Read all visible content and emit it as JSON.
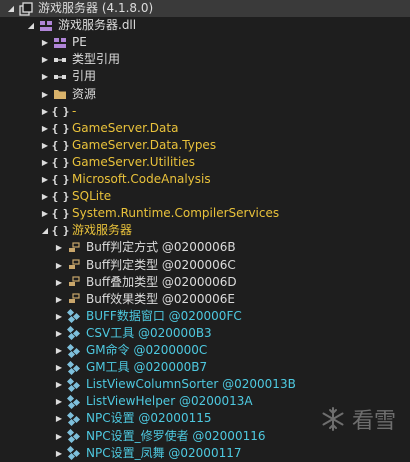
{
  "colors": {
    "namespace_text": "#e9c23b",
    "type_text": "#4ec9e0",
    "default_text": "#dcdcdc",
    "enum_icon": "#c9a66b",
    "class_icon": "#7ec0dc"
  },
  "tree": [
    {
      "label": "游戏服务器 (4.1.8.0)",
      "indent": 0,
      "arrow": "down",
      "icon": "assembly-icon",
      "color": "#dcdcdc",
      "selected": true
    },
    {
      "label": "游戏服务器.dll",
      "indent": 1,
      "arrow": "down",
      "icon": "module-icon",
      "color": "#dcdcdc"
    },
    {
      "label": "PE",
      "indent": 2,
      "arrow": "right",
      "icon": "pe-icon",
      "color": "#dcdcdc"
    },
    {
      "label": "类型引用",
      "indent": 2,
      "arrow": "right",
      "icon": "type-ref-icon",
      "color": "#dcdcdc"
    },
    {
      "label": "引用",
      "indent": 2,
      "arrow": "right",
      "icon": "reference-icon",
      "color": "#dcdcdc"
    },
    {
      "label": "资源",
      "indent": 2,
      "arrow": "right",
      "icon": "folder-icon",
      "color": "#dcdcdc"
    },
    {
      "label": "-",
      "indent": 2,
      "arrow": "right",
      "icon": "namespace-icon",
      "color": "#e9c23b"
    },
    {
      "label": "GameServer.Data",
      "indent": 2,
      "arrow": "right",
      "icon": "namespace-icon",
      "color": "#e9c23b"
    },
    {
      "label": "GameServer.Data.Types",
      "indent": 2,
      "arrow": "right",
      "icon": "namespace-icon",
      "color": "#e9c23b"
    },
    {
      "label": "GameServer.Utilities",
      "indent": 2,
      "arrow": "right",
      "icon": "namespace-icon",
      "color": "#e9c23b"
    },
    {
      "label": "Microsoft.CodeAnalysis",
      "indent": 2,
      "arrow": "right",
      "icon": "namespace-icon",
      "color": "#e9c23b"
    },
    {
      "label": "SQLite",
      "indent": 2,
      "arrow": "right",
      "icon": "namespace-icon",
      "color": "#e9c23b"
    },
    {
      "label": "System.Runtime.CompilerServices",
      "indent": 2,
      "arrow": "right",
      "icon": "namespace-icon",
      "color": "#e9c23b"
    },
    {
      "label": "游戏服务器",
      "indent": 2,
      "arrow": "down",
      "icon": "namespace-icon",
      "color": "#e9c23b"
    },
    {
      "label": "Buff判定方式 @0200006B",
      "indent": 3,
      "arrow": "right",
      "icon": "enum-icon",
      "color": "#dcdcdc"
    },
    {
      "label": "Buff判定类型 @0200006C",
      "indent": 3,
      "arrow": "right",
      "icon": "enum-icon",
      "color": "#dcdcdc"
    },
    {
      "label": "Buff叠加类型 @0200006D",
      "indent": 3,
      "arrow": "right",
      "icon": "enum-icon",
      "color": "#dcdcdc"
    },
    {
      "label": "Buff效果类型 @0200006E",
      "indent": 3,
      "arrow": "right",
      "icon": "enum-icon",
      "color": "#dcdcdc"
    },
    {
      "label": "BUFF数据窗口 @020000FC",
      "indent": 3,
      "arrow": "right",
      "icon": "class-icon",
      "color": "#4ec9e0"
    },
    {
      "label": "CSV工具 @020000B3",
      "indent": 3,
      "arrow": "right",
      "icon": "class-icon",
      "color": "#4ec9e0"
    },
    {
      "label": "GM命令 @0200000C",
      "indent": 3,
      "arrow": "right",
      "icon": "class-icon",
      "color": "#4ec9e0"
    },
    {
      "label": "GM工具 @020000B7",
      "indent": 3,
      "arrow": "right",
      "icon": "class-icon",
      "color": "#4ec9e0"
    },
    {
      "label": "ListViewColumnSorter @0200013B",
      "indent": 3,
      "arrow": "right",
      "icon": "class-icon",
      "color": "#4ec9e0"
    },
    {
      "label": "ListViewHelper @0200013A",
      "indent": 3,
      "arrow": "right",
      "icon": "class-icon",
      "color": "#4ec9e0"
    },
    {
      "label": "NPC设置 @02000115",
      "indent": 3,
      "arrow": "right",
      "icon": "class-icon",
      "color": "#4ec9e0"
    },
    {
      "label": "NPC设置_修罗使者 @02000116",
      "indent": 3,
      "arrow": "right",
      "icon": "class-icon",
      "color": "#4ec9e0"
    },
    {
      "label": "NPC设置_凤舞 @02000117",
      "indent": 3,
      "arrow": "right",
      "icon": "class-icon",
      "color": "#4ec9e0"
    }
  ],
  "watermark": {
    "text": "看雪",
    "icon": "snowflake-logo-icon"
  }
}
